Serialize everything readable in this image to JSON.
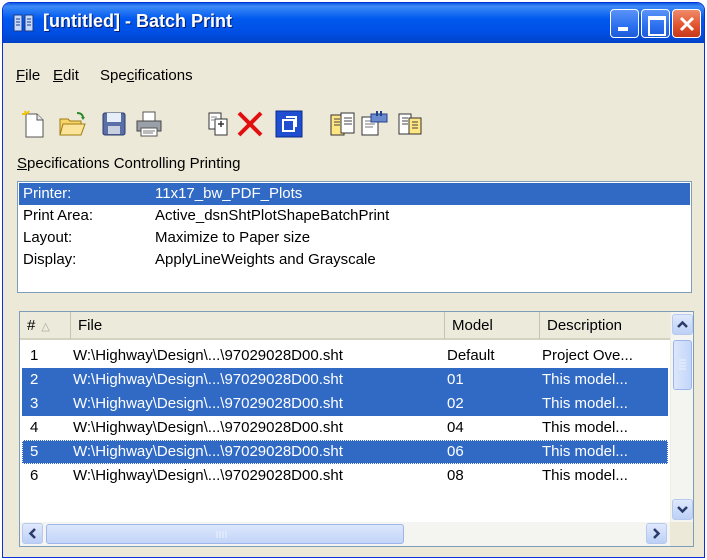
{
  "window": {
    "title": "[untitled] - Batch Print"
  },
  "menu": [
    {
      "label": "File",
      "mnemonic": "F"
    },
    {
      "label": "Edit",
      "mnemonic": "E"
    },
    {
      "label": "Specifications",
      "mnemonic": "c"
    }
  ],
  "toolbar": {
    "buttons": [
      "new-file-icon",
      "open-folder-icon",
      "save-icon",
      "print-icon",
      "add-file-icon",
      "delete-icon",
      "select-all-icon",
      "printer-setup-icon",
      "print-area-icon",
      "layout-icon"
    ]
  },
  "specs": {
    "label": "Specifications Controlling Printing",
    "rows": [
      {
        "key": "Printer:",
        "value": "11x17_bw_PDF_Plots",
        "selected": true
      },
      {
        "key": "Print Area:",
        "value": "Active_dsnShtPlotShapeBatchPrint",
        "selected": false
      },
      {
        "key": "Layout:",
        "value": "Maximize to Paper size",
        "selected": false
      },
      {
        "key": "Display:",
        "value": "ApplyLineWeights and Grayscale",
        "selected": false
      }
    ]
  },
  "list": {
    "columns": {
      "num": "#",
      "file": "File",
      "model": "Model",
      "description": "Description"
    },
    "rows": [
      {
        "num": "1",
        "file": "W:\\Highway\\Design\\...\\97029028D00.sht",
        "model": "Default",
        "description": "Project Ove...",
        "selected": false
      },
      {
        "num": "2",
        "file": "W:\\Highway\\Design\\...\\97029028D00.sht",
        "model": "01",
        "description": "This model...",
        "selected": true
      },
      {
        "num": "3",
        "file": "W:\\Highway\\Design\\...\\97029028D00.sht",
        "model": "02",
        "description": "This model...",
        "selected": true
      },
      {
        "num": "4",
        "file": "W:\\Highway\\Design\\...\\97029028D00.sht",
        "model": "04",
        "description": "This model...",
        "selected": false
      },
      {
        "num": "5",
        "file": "W:\\Highway\\Design\\...\\97029028D00.sht",
        "model": "06",
        "description": "This model...",
        "selected": true
      },
      {
        "num": "6",
        "file": "W:\\Highway\\Design\\...\\97029028D00.sht",
        "model": "08",
        "description": "This model...",
        "selected": false
      }
    ]
  },
  "colors": {
    "title_bar": "#0058ee",
    "selection": "#316ac5",
    "window_bg": "#ece9d8"
  }
}
